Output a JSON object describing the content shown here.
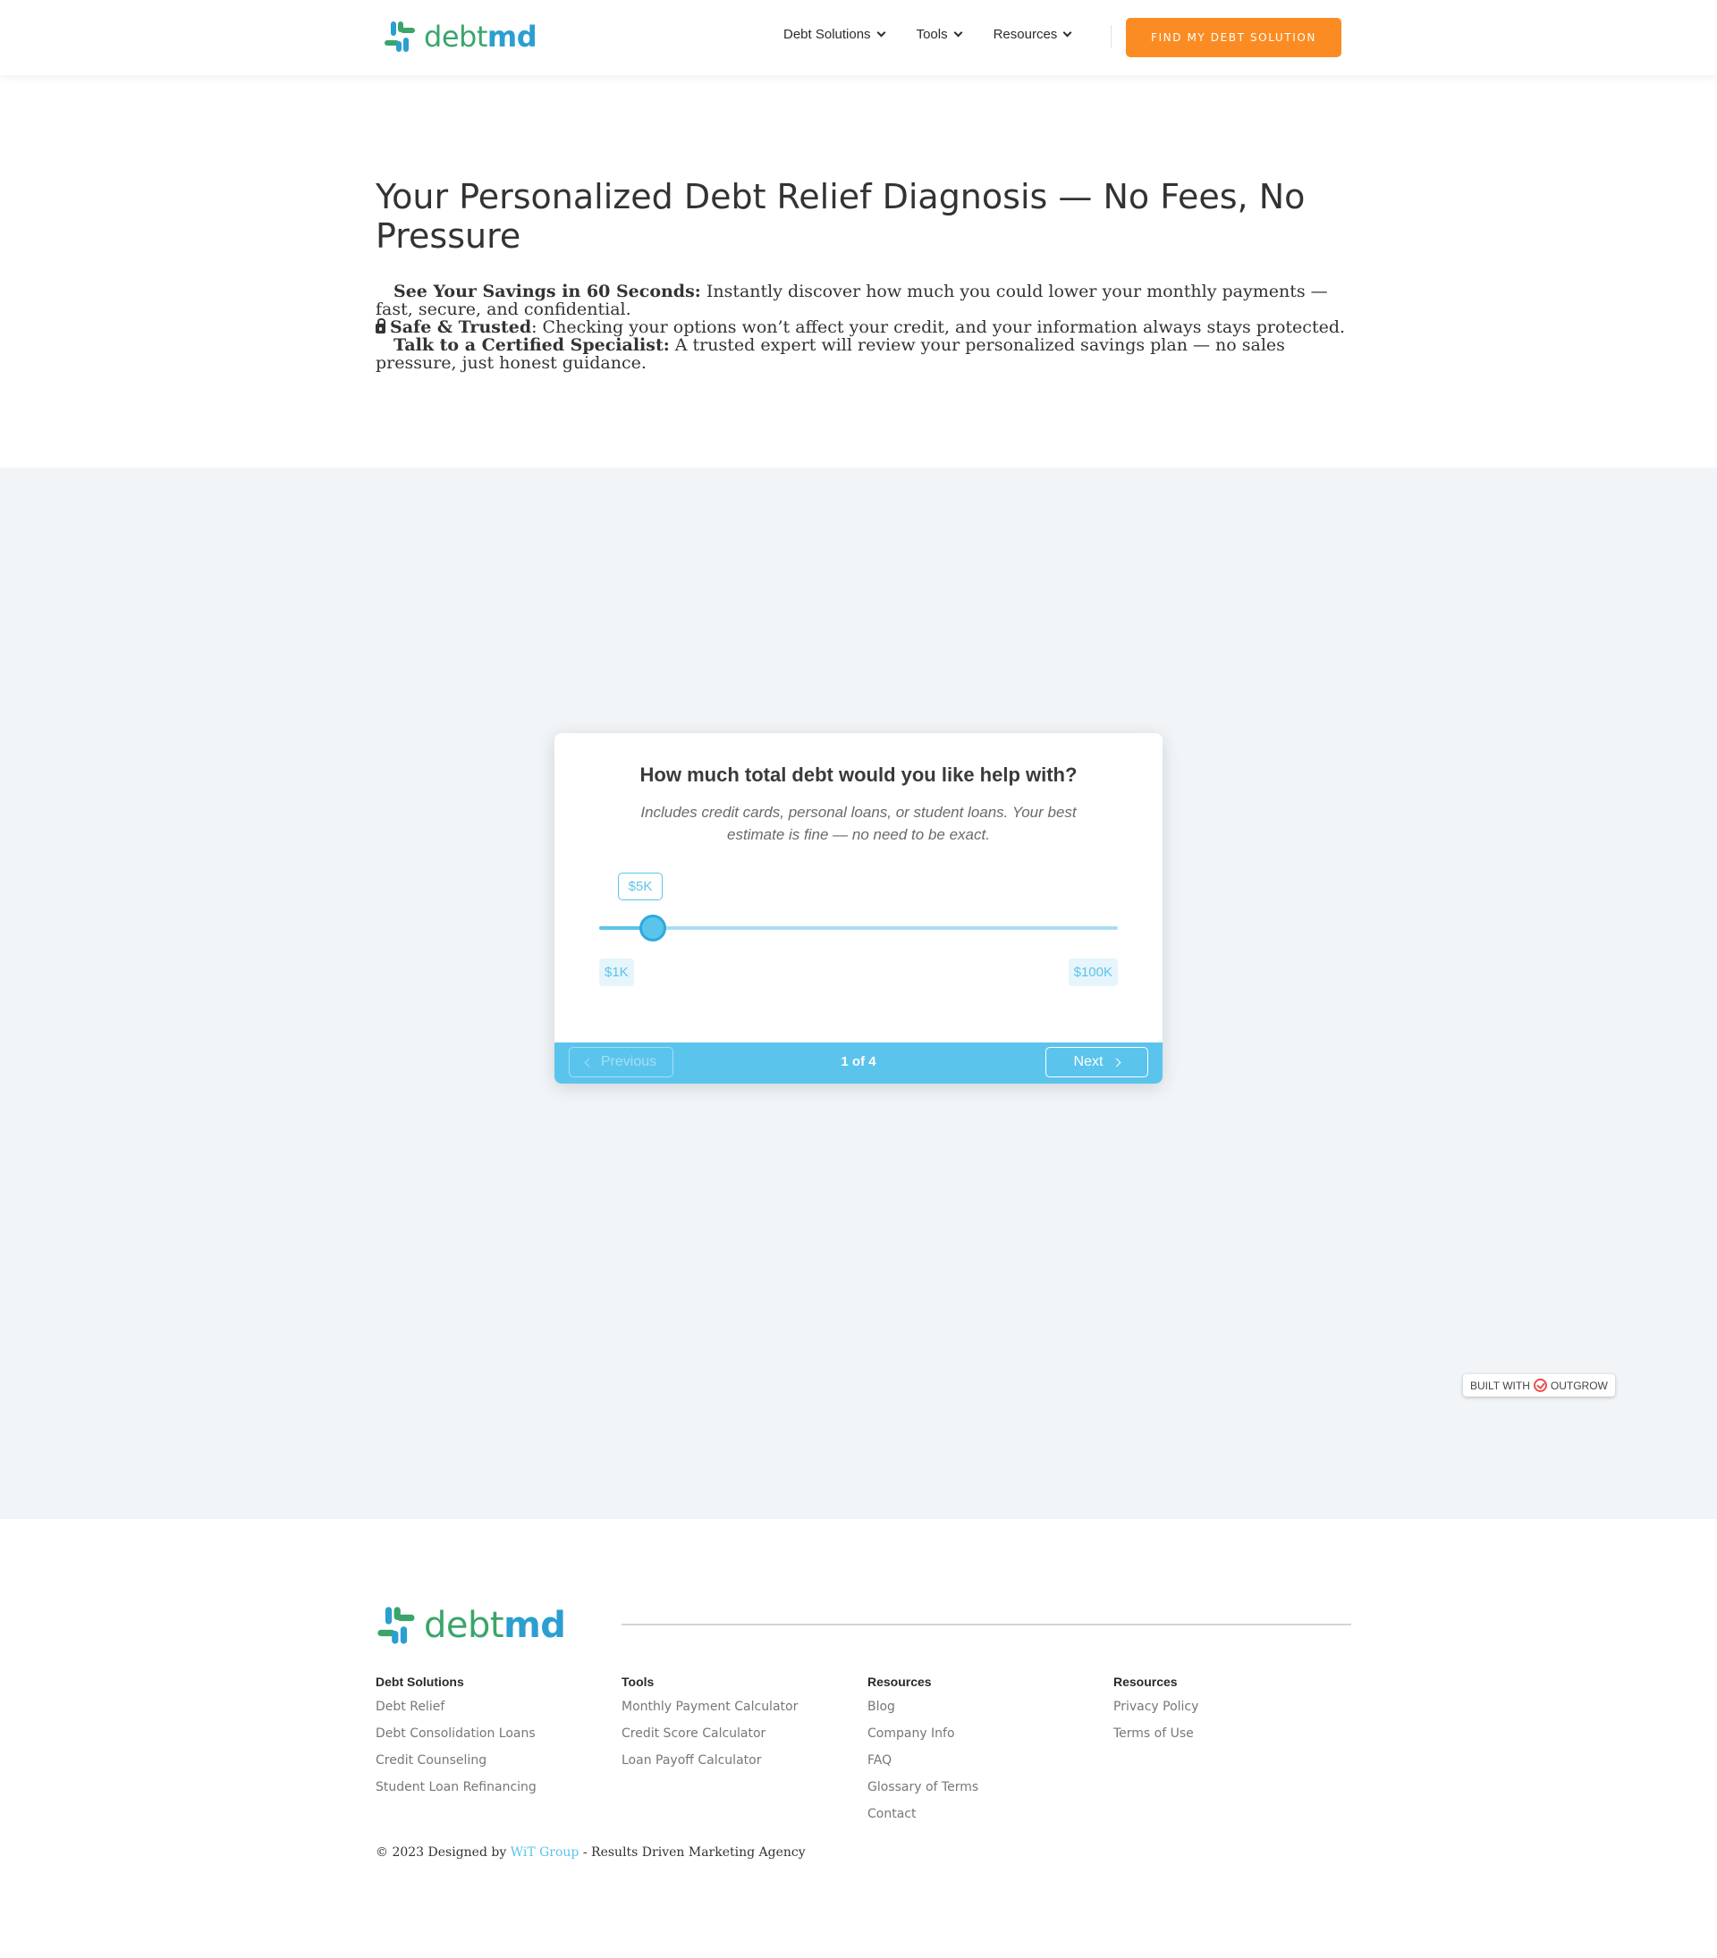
{
  "brand": {
    "logo_part1": "debt",
    "logo_part2": "md",
    "green": "#3aa56b",
    "blue": "#2b9fd0"
  },
  "nav": {
    "items": [
      {
        "label": "Debt Solutions"
      },
      {
        "label": "Tools"
      },
      {
        "label": "Resources"
      }
    ],
    "cta": "FIND MY DEBT SOLUTION",
    "cta_color": "#fb8c24"
  },
  "hero": {
    "title": "Your Personalized Debt Relief Diagnosis — No Fees, No Pressure",
    "points": [
      {
        "strong": "See Your Savings in 60 Seconds:",
        "text": " Instantly discover how much you could lower your monthly payments — fast, secure, and confidential."
      },
      {
        "strong": "Safe & Trusted",
        "text": ": Checking your options won’t affect your credit, and your information always stays protected."
      },
      {
        "strong": "Talk to a Certified Specialist:",
        "text": " A trusted expert will review your personalized savings plan — no sales pressure, just honest guidance."
      }
    ]
  },
  "calculator": {
    "question": "How much total debt would you like help with?",
    "subtitle": "Includes credit cards, personal loans, or student loans. Your best estimate is fine — no need to be exact.",
    "slider": {
      "value_label": "$5K",
      "min_label": "$1K",
      "max_label": "$100K",
      "value": 5,
      "min": 1,
      "max": 100
    },
    "prev_label": "Previous",
    "next_label": "Next",
    "step_text": "1 of 4",
    "accent": "#5bc4ec"
  },
  "badge": {
    "left": "BUILT WITH",
    "right": "OUTGROW"
  },
  "footer": {
    "columns": [
      {
        "heading": "Debt Solutions",
        "links": [
          "Debt Relief",
          "Debt Consolidation Loans",
          "Credit Counseling",
          "Student Loan Refinancing"
        ]
      },
      {
        "heading": "Tools",
        "links": [
          "Monthly Payment Calculator",
          "Credit Score Calculator",
          "Loan Payoff Calculator"
        ]
      },
      {
        "heading": "Resources",
        "links": [
          "Blog",
          "Company Info",
          "FAQ",
          "Glossary of Terms",
          "Contact"
        ]
      },
      {
        "heading": "Resources",
        "links": [
          "Privacy Policy",
          "Terms of Use"
        ]
      }
    ],
    "copyright_prefix": "© 2023 Designed by ",
    "copyright_link": "WiT Group",
    "copyright_suffix": " - Results Driven Marketing Agency"
  }
}
